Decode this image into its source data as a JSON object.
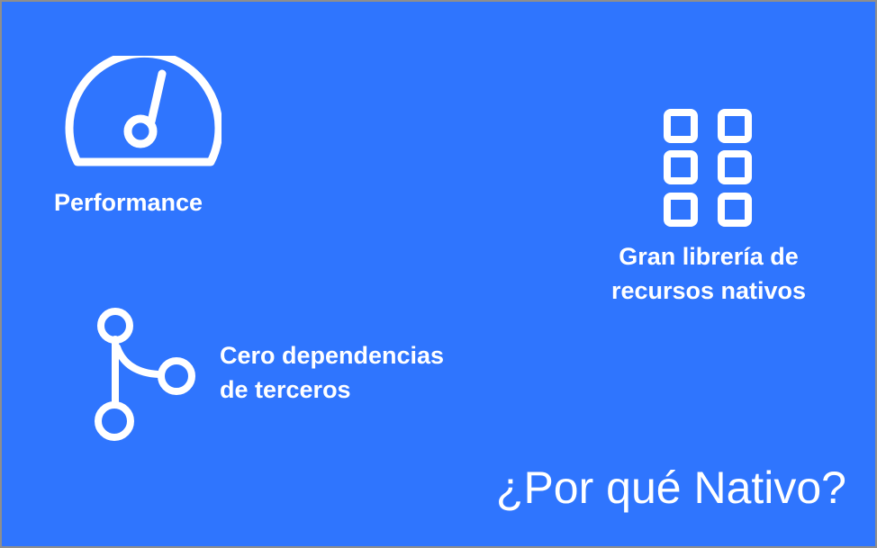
{
  "slide": {
    "background_color": "#2f75fe",
    "title": "¿Por qué Nativo?"
  },
  "features": {
    "performance": {
      "icon": "speedometer-icon",
      "label": "Performance"
    },
    "library": {
      "icon": "grid-icon",
      "label_line1": "Gran librería de",
      "label_line2": "recursos nativos"
    },
    "dependencies": {
      "icon": "branch-icon",
      "label_line1": "Cero dependencias",
      "label_line2": "de terceros"
    }
  }
}
